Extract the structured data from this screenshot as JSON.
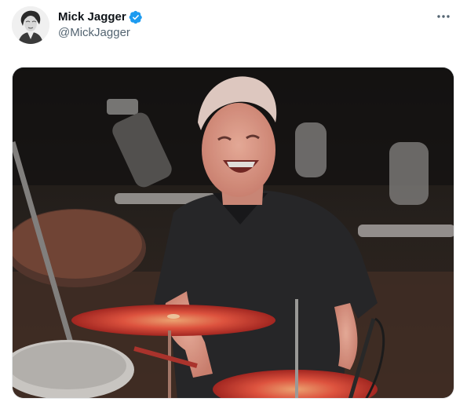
{
  "tweet": {
    "author": {
      "display_name": "Mick Jagger",
      "handle": "@MickJagger",
      "verified": true,
      "avatar_icon": "portrait-avatar"
    },
    "more_icon": "more-options-icon",
    "media": {
      "type": "photo",
      "icon": "photo-drummer"
    }
  },
  "colors": {
    "verified_blue": "#1d9bf0",
    "handle_gray": "#536471",
    "text": "#0f1419",
    "cymbal_red": "#e0463c"
  }
}
